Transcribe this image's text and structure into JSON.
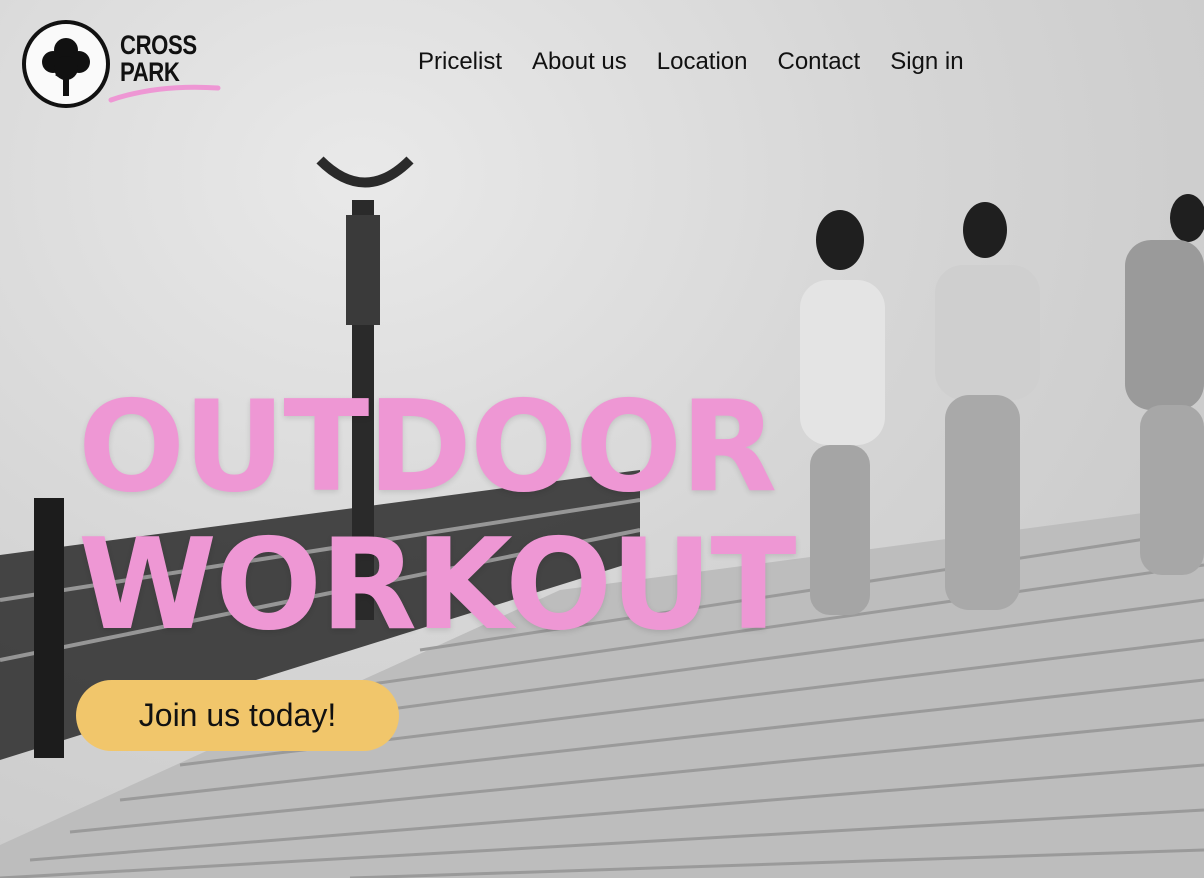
{
  "logo": {
    "line1": "CROSS",
    "line2": "PARK"
  },
  "nav": {
    "items": [
      {
        "label": "Pricelist"
      },
      {
        "label": "About us"
      },
      {
        "label": "Location"
      },
      {
        "label": "Contact"
      },
      {
        "label": "Sign in"
      }
    ]
  },
  "hero": {
    "headline_line1": "OUTDOOR",
    "headline_line2": "WORKOUT",
    "cta_label": "Join us today!"
  },
  "colors": {
    "headline": "#ee97d4",
    "cta_background": "#f1c66b",
    "logo_swash": "#ee97d4",
    "text": "#111111"
  },
  "icons": {
    "logo_mark": "tree-icon"
  }
}
